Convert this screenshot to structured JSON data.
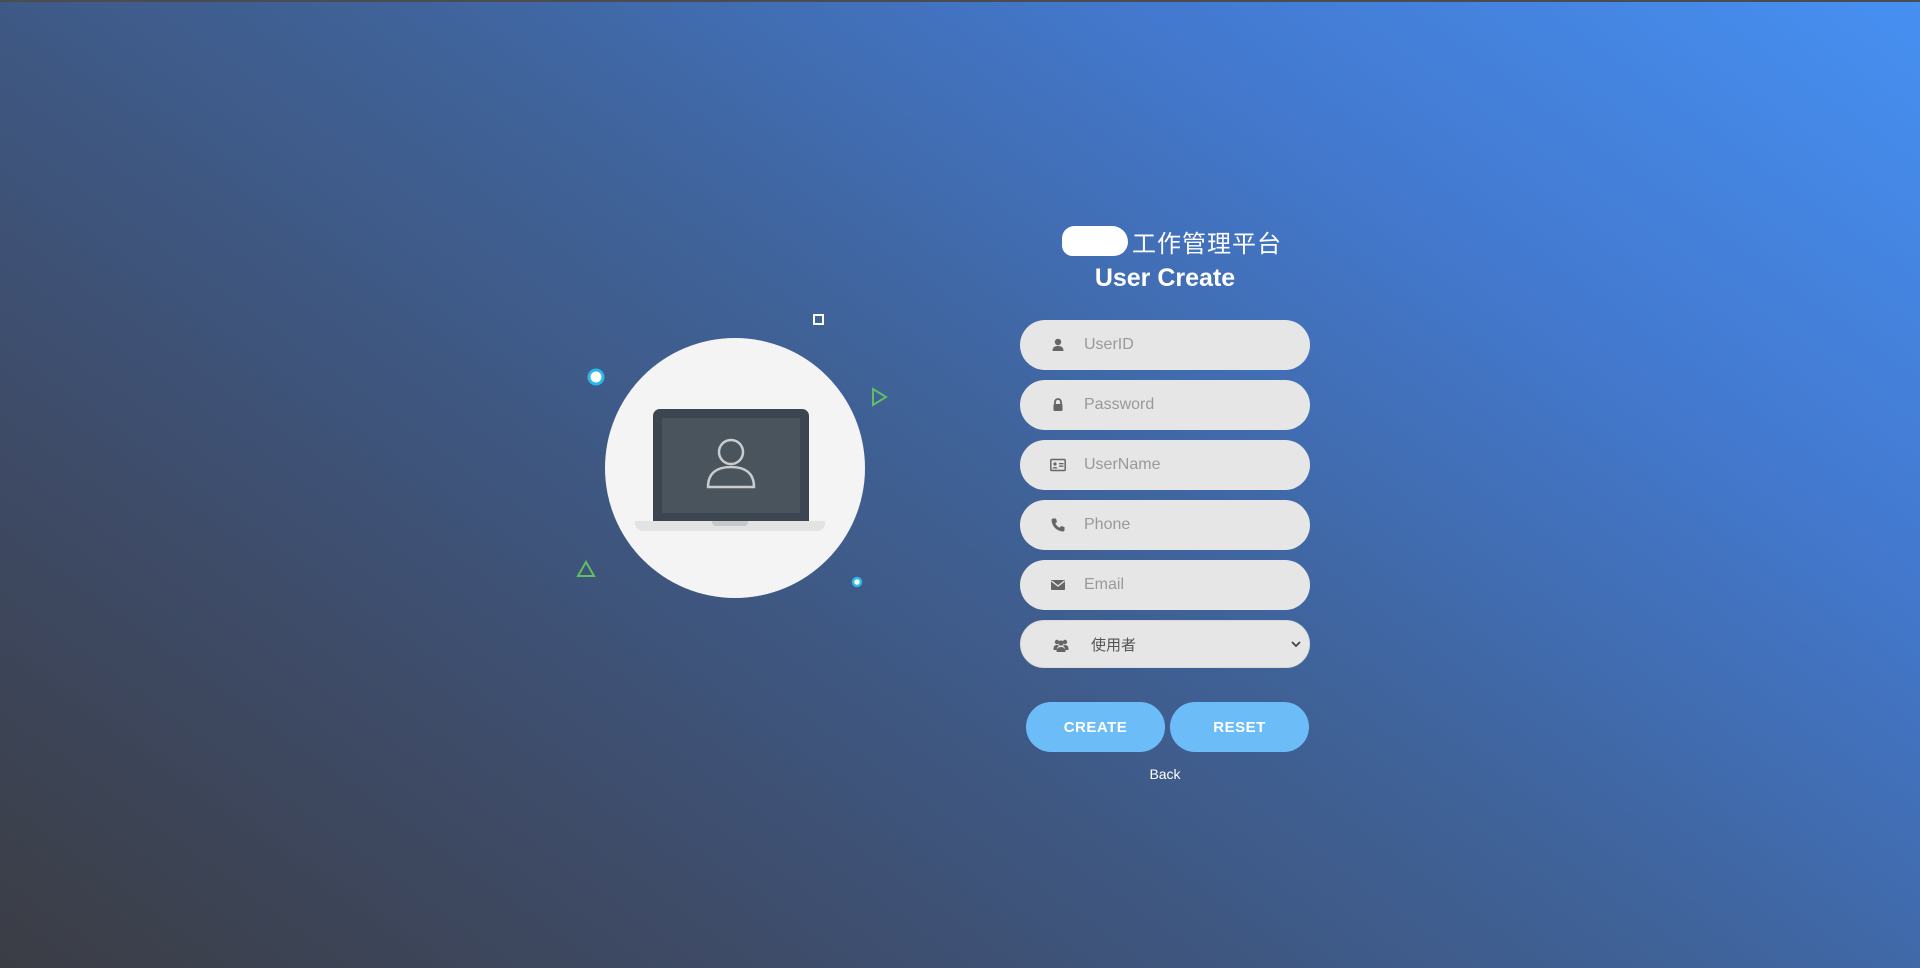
{
  "header": {
    "brand_text": "工作管理平台",
    "title": "User Create"
  },
  "form": {
    "fields": [
      {
        "name": "userid",
        "placeholder": "UserID",
        "icon": "user-icon"
      },
      {
        "name": "password",
        "placeholder": "Password",
        "icon": "lock-icon"
      },
      {
        "name": "username",
        "placeholder": "UserName",
        "icon": "id-card-icon"
      },
      {
        "name": "phone",
        "placeholder": "Phone",
        "icon": "phone-icon"
      },
      {
        "name": "email",
        "placeholder": "Email",
        "icon": "envelope-icon"
      }
    ],
    "role_select": {
      "icon": "users-icon",
      "selected": "使用者",
      "options": [
        "使用者"
      ]
    },
    "create_label": "CREATE",
    "reset_label": "RESET",
    "back_label": "Back"
  },
  "illustration": {
    "icons": [
      "laptop-icon",
      "user-avatar-icon"
    ]
  },
  "colors": {
    "button": "#6cbcf7",
    "field_bg": "#e6e6e6",
    "deco_cyan": "#2bb7e8",
    "deco_green": "#5fbf62"
  }
}
